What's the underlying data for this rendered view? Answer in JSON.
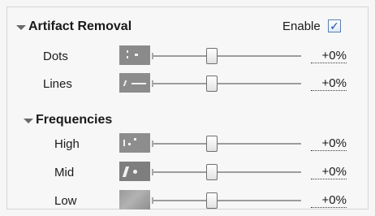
{
  "artifact_removal": {
    "title": "Artifact Removal",
    "enable_label": "Enable",
    "enabled_mark": "✓",
    "enabled": true,
    "rows": [
      {
        "label": "Dots",
        "value": "+0%",
        "slider_level": 0.5
      },
      {
        "label": "Lines",
        "value": "+0%",
        "slider_level": 0.5
      }
    ]
  },
  "frequencies": {
    "title": "Frequencies",
    "rows": [
      {
        "label": "High",
        "value": "+0%",
        "slider_level": 0.5
      },
      {
        "label": "Mid",
        "value": "+0%",
        "slider_level": 0.5
      },
      {
        "label": "Low",
        "value": "+0%",
        "slider_level": 0.5
      }
    ]
  },
  "icons": {
    "section_toggle": "disclosure-triangle-icon",
    "dots": "dots-preview-icon",
    "lines": "lines-preview-icon",
    "high": "high-frequency-preview-icon",
    "mid": "mid-frequency-preview-icon",
    "low": "low-frequency-preview-icon"
  }
}
